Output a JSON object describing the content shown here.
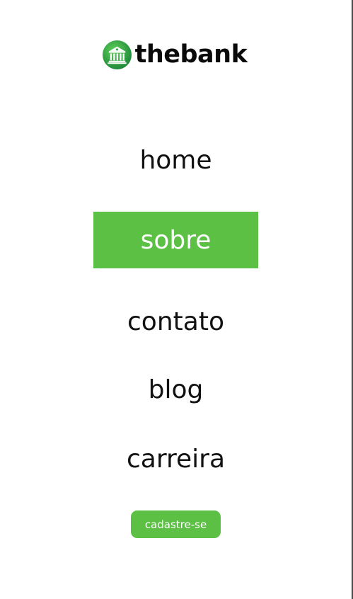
{
  "brand": {
    "name": "thebank",
    "icon": "bank-building-icon",
    "icon_color": "#3aa64a"
  },
  "nav": {
    "items": [
      {
        "label": "home",
        "active": false
      },
      {
        "label": "sobre",
        "active": true
      },
      {
        "label": "contato",
        "active": false
      },
      {
        "label": "blog",
        "active": false
      },
      {
        "label": "carreira",
        "active": false
      }
    ]
  },
  "cta": {
    "label": "cadastre-se"
  },
  "colors": {
    "accent": "#5bc044",
    "text": "#111111",
    "background": "#ffffff"
  }
}
